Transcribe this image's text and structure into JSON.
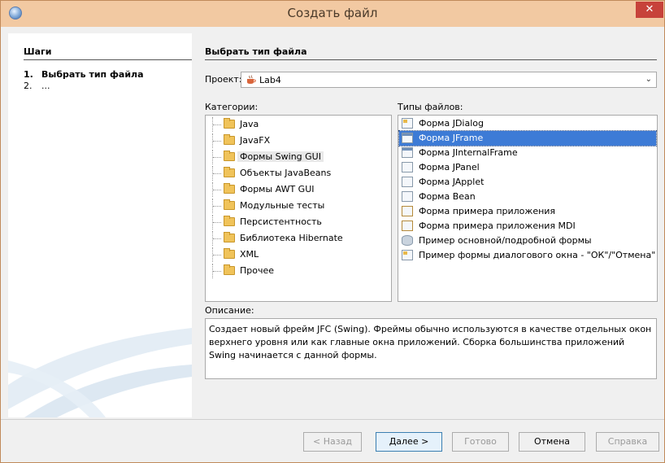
{
  "window": {
    "title": "Создать файл",
    "close_glyph": "✕"
  },
  "steps": {
    "title": "Шаги",
    "items": [
      {
        "num": "1.",
        "label": "Выбрать тип файла"
      },
      {
        "num": "2.",
        "label": "..."
      }
    ]
  },
  "main": {
    "title": "Выбрать тип файла",
    "project_label": "Проект:",
    "project_value": "Lab4",
    "categories_label": "Категории:",
    "file_types_label": "Типы файлов:",
    "categories": [
      "Java",
      "JavaFX",
      "Формы Swing GUI",
      "Объекты JavaBeans",
      "Формы AWT GUI",
      "Модульные тесты",
      "Персистентность",
      "Библиотека Hibernate",
      "XML",
      "Прочее"
    ],
    "selected_category": "Формы Swing GUI",
    "file_types": [
      "Форма JDialog",
      "Форма JFrame",
      "Форма JInternalFrame",
      "Форма JPanel",
      "Форма JApplet",
      "Форма Bean",
      "Форма примера приложения",
      "Форма примера приложения MDI",
      "Пример основной/подробной формы",
      "Пример формы диалогового окна - \"ОК\"/\"Отмена\""
    ],
    "selected_file_type": "Форма JFrame",
    "description_label": "Описание:",
    "description": "Создает новый фрейм JFC (Swing). Фреймы обычно используются в качестве отдельных окон верхнего уровня или как главные окна приложений. Сборка большинства приложений Swing начинается с данной формы."
  },
  "buttons": {
    "back": "< Назад",
    "next": "Далее >",
    "finish": "Готово",
    "cancel": "Отмена",
    "help": "Справка"
  },
  "colors": {
    "titlebar": "#f2c9a2",
    "selection": "#3d7bd6",
    "close": "#c7423a"
  }
}
